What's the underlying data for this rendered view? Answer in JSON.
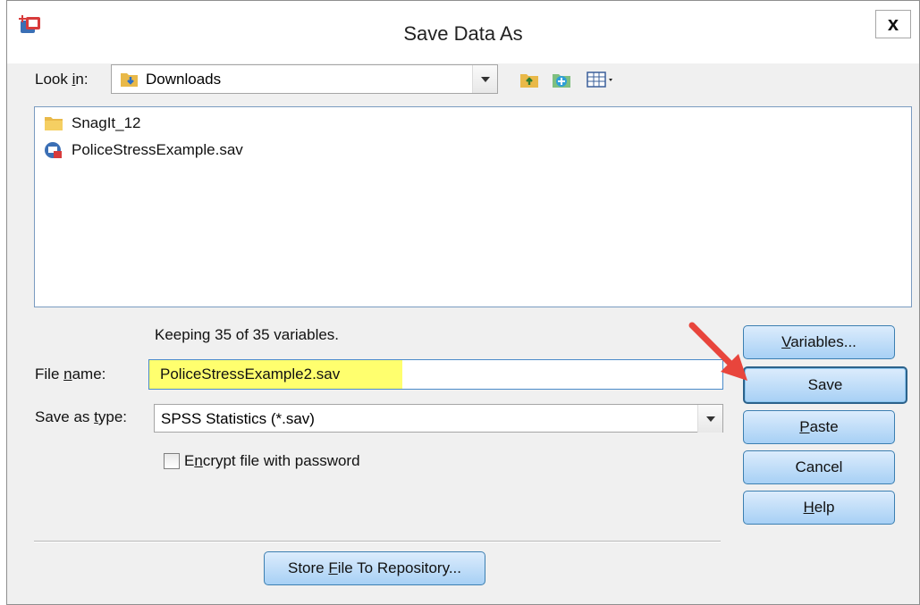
{
  "window": {
    "title": "Save Data As",
    "close_label": "x"
  },
  "look_in": {
    "label": "Look in:",
    "value": "Downloads"
  },
  "toolbar": {
    "icons": [
      "up-folder-icon",
      "new-folder-icon",
      "view-menu-icon"
    ]
  },
  "files": [
    {
      "name": "SnagIt_12",
      "icon": "folder-icon"
    },
    {
      "name": "PoliceStressExample.sav",
      "icon": "spss-file-icon"
    }
  ],
  "status": {
    "keeping_text": "Keeping 35 of 35 variables."
  },
  "file_name": {
    "label": "File name:",
    "value": "PoliceStressExample2.sav",
    "highlight_color": "#ffff6e"
  },
  "save_as_type": {
    "label": "Save as type:",
    "value": "SPSS Statistics (*.sav)"
  },
  "encrypt": {
    "label": "Encrypt file with password",
    "checked": false
  },
  "buttons": {
    "variables": "Variables...",
    "save": "Save",
    "paste": "Paste",
    "cancel": "Cancel",
    "help": "Help",
    "store": "Store File To Repository..."
  },
  "colors": {
    "button_top": "#dcecfc",
    "button_bottom": "#a7d0f5",
    "button_border": "#3c7fb1",
    "annotation_arrow": "#e8453c"
  }
}
